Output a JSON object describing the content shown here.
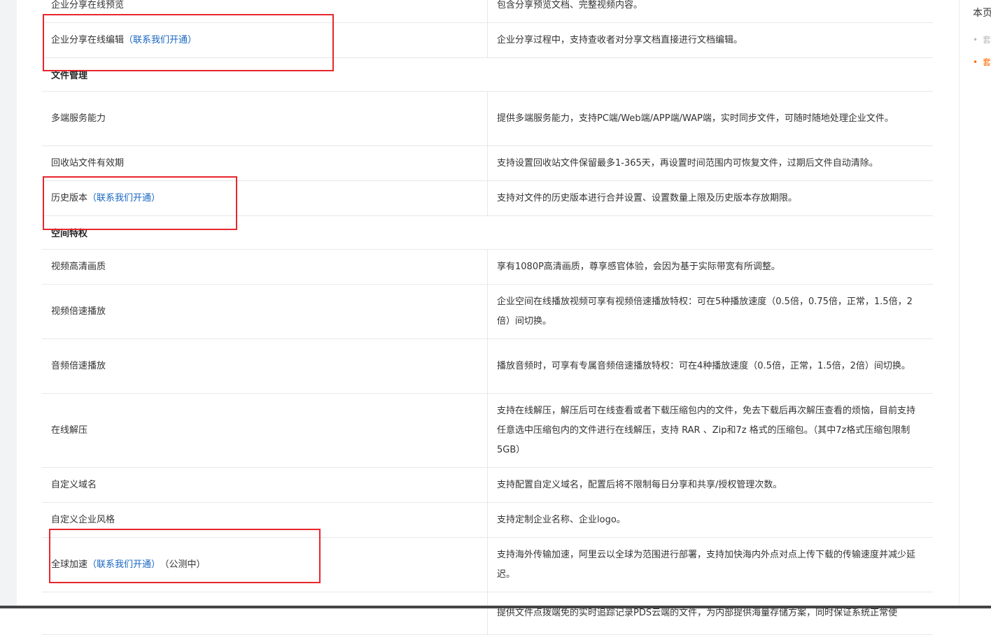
{
  "rows": [
    {
      "type": "feature",
      "name": "企业分享在线预览",
      "desc": "包含分享预览文档、完整视频内容。",
      "height": 48
    },
    {
      "type": "feature",
      "name": "企业分享在线编辑",
      "link": "（联系我们开通）",
      "desc": "企业分享过程中，支持查收者对分享文档直接进行文档编辑。",
      "height": 49
    },
    {
      "type": "section",
      "name": "文件管理"
    },
    {
      "type": "feature",
      "name": "多端服务能力",
      "desc": "提供多端服务能力，支持PC端/Web端/APP端/WAP端，实时同步文件，可随时随地处理企业文件。",
      "height": 77
    },
    {
      "type": "feature",
      "name": "回收站文件有效期",
      "desc": "支持设置回收站文件保留最多1-365天，再设置时间范围内可恢复文件，过期后文件自动清除。",
      "height": 49
    },
    {
      "type": "feature",
      "name": "历史版本",
      "link": "（联系我们开通）",
      "desc": "支持对文件的历史版本进行合并设置、设置数量上限及历史版本存放期限。",
      "height": 49
    },
    {
      "type": "section",
      "name": "空间特权"
    },
    {
      "type": "feature",
      "name": "视频高清画质",
      "desc": "享有1080P高清画质，尊享感官体验，会因为基于实际带宽有所调整。",
      "height": 49
    },
    {
      "type": "feature",
      "name": "视频倍速播放",
      "desc": "企业空间在线播放视频可享有视频倍速播放特权：可在5种播放速度（0.5倍，0.75倍，正常，1.5倍，2倍）间切换。",
      "height": 77
    },
    {
      "type": "feature",
      "name": "音频倍速播放",
      "desc": "播放音频时，可享有专属音频倍速播放特权：可在4种播放速度（0.5倍，正常，1.5倍，2倍）间切换。",
      "height": 77
    },
    {
      "type": "feature",
      "name": "在线解压",
      "desc": "支持在线解压，解压后可在线查看或者下载压缩包内的文件，免去下载后再次解压查看的烦恼，目前支持任意选中压缩包内的文件进行在线解压，支持 RAR 、Zip和7z 格式的压缩包。（其中7z格式压缩包限制5GB）",
      "height": 105
    },
    {
      "type": "feature",
      "name": "自定义域名",
      "desc": "支持配置自定义域名，配置后将不限制每日分享和共享/授权管理次数。",
      "height": 49
    },
    {
      "type": "feature",
      "name": "自定义企业风格",
      "desc": "支持定制企业名称、企业logo。",
      "height": 49
    },
    {
      "type": "feature",
      "name": "全球加速",
      "link": "（联系我们开通）",
      "suffix": "（公测中）",
      "desc": "支持海外传输加速，阿里云以全球为范围进行部署，支持加快海内外点对点上传下载的传输速度并减少延迟。",
      "height": 77
    },
    {
      "type": "feature",
      "name": "",
      "desc": "提供文件点拨端免的实时追踪记录PDS云端的文件，为内部提供海量存储方案，同时保证系统正常使",
      "height": 60
    }
  ],
  "toc": {
    "title": "本页",
    "items": [
      {
        "label": "套",
        "color": "#bbbbbb"
      },
      {
        "label": "套",
        "color": "#ff6a00"
      }
    ]
  }
}
